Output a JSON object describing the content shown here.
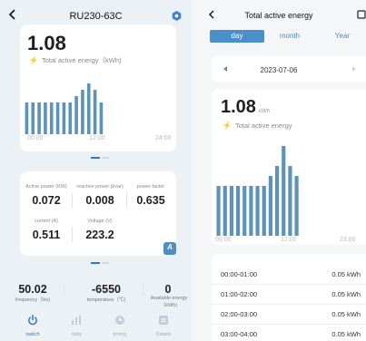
{
  "left": {
    "device_name": "RU230-63C",
    "energy": {
      "value": "1.08",
      "label": "Total active energy（kWh)",
      "x_ticks": [
        "00:00",
        "12:00",
        "24:00"
      ]
    },
    "chart_data": {
      "type": "bar",
      "title": "",
      "ylabel": "",
      "x": [
        "00:00",
        "01:00",
        "02:00",
        "03:00",
        "04:00",
        "05:00",
        "06:00",
        "07:00",
        "08:00",
        "09:00",
        "10:00",
        "11:00",
        "12:00"
      ],
      "values": [
        0.05,
        0.05,
        0.05,
        0.05,
        0.05,
        0.05,
        0.05,
        0.05,
        0.06,
        0.07,
        0.08,
        0.07,
        0.05
      ],
      "x_ticks": [
        "00:00",
        "12:00",
        "24:00"
      ],
      "color": "#5b93bb"
    },
    "metrics": {
      "active_power_label": "Active power (KW)",
      "active_power_value": "0.072",
      "reactive_power_label": "reactive power (kvar)",
      "reactive_power_value": "0.008",
      "power_factor_label": "power factor",
      "power_factor_value": "0.635",
      "current_label": "current (A)",
      "current_value": "0.511",
      "voltage_label": "Voltage (V)",
      "voltage_value": "223.2",
      "badge": "A"
    },
    "bottom_stats": {
      "frequency_value": "50.02",
      "frequency_label": "frequency（Hz)",
      "temperature_value": "-6550",
      "temperature_label": "temperature（℃)",
      "available_energy_value": "0",
      "available_energy_label": "Available energy（kWh)"
    },
    "nav": [
      {
        "label": "switch",
        "icon": "power-icon",
        "active": true
      },
      {
        "label": "data",
        "icon": "bar-chart-icon",
        "active": false
      },
      {
        "label": "timing",
        "icon": "clock-icon",
        "active": false
      },
      {
        "label": "Details",
        "icon": "details-icon",
        "active": false
      }
    ]
  },
  "right": {
    "title": "Total active energy",
    "tabs": [
      "day",
      "month",
      "Year"
    ],
    "active_tab": "day",
    "date": "2023-07-06",
    "energy_value": "1.08",
    "energy_unit": "kWh",
    "energy_label": "Total active energy",
    "chart_data": {
      "type": "bar",
      "title": "",
      "ylabel": "",
      "x": [
        "00:00",
        "01:00",
        "02:00",
        "03:00",
        "04:00",
        "05:00",
        "06:00",
        "07:00",
        "08:00",
        "09:00",
        "10:00",
        "11:00",
        "12:00"
      ],
      "values": [
        0.05,
        0.05,
        0.05,
        0.05,
        0.05,
        0.05,
        0.05,
        0.05,
        0.06,
        0.07,
        0.09,
        0.07,
        0.06
      ],
      "x_ticks": [
        "00:00",
        "12:00",
        "23:00"
      ],
      "color": "#5b93bb"
    },
    "rows": [
      {
        "time": "00:00-01:00",
        "value": "0.05 kWh"
      },
      {
        "time": "01:00-02:00",
        "value": "0.05 kWh"
      },
      {
        "time": "02:00-03:00",
        "value": "0.05 kWh"
      },
      {
        "time": "03:00-04:00",
        "value": "0.05 kWh"
      }
    ]
  },
  "colors": {
    "accent": "#2c74d6",
    "bar": "#5b93bb",
    "tab_active_bg": "#4a8fc9",
    "bolt": "#f2b31a"
  }
}
